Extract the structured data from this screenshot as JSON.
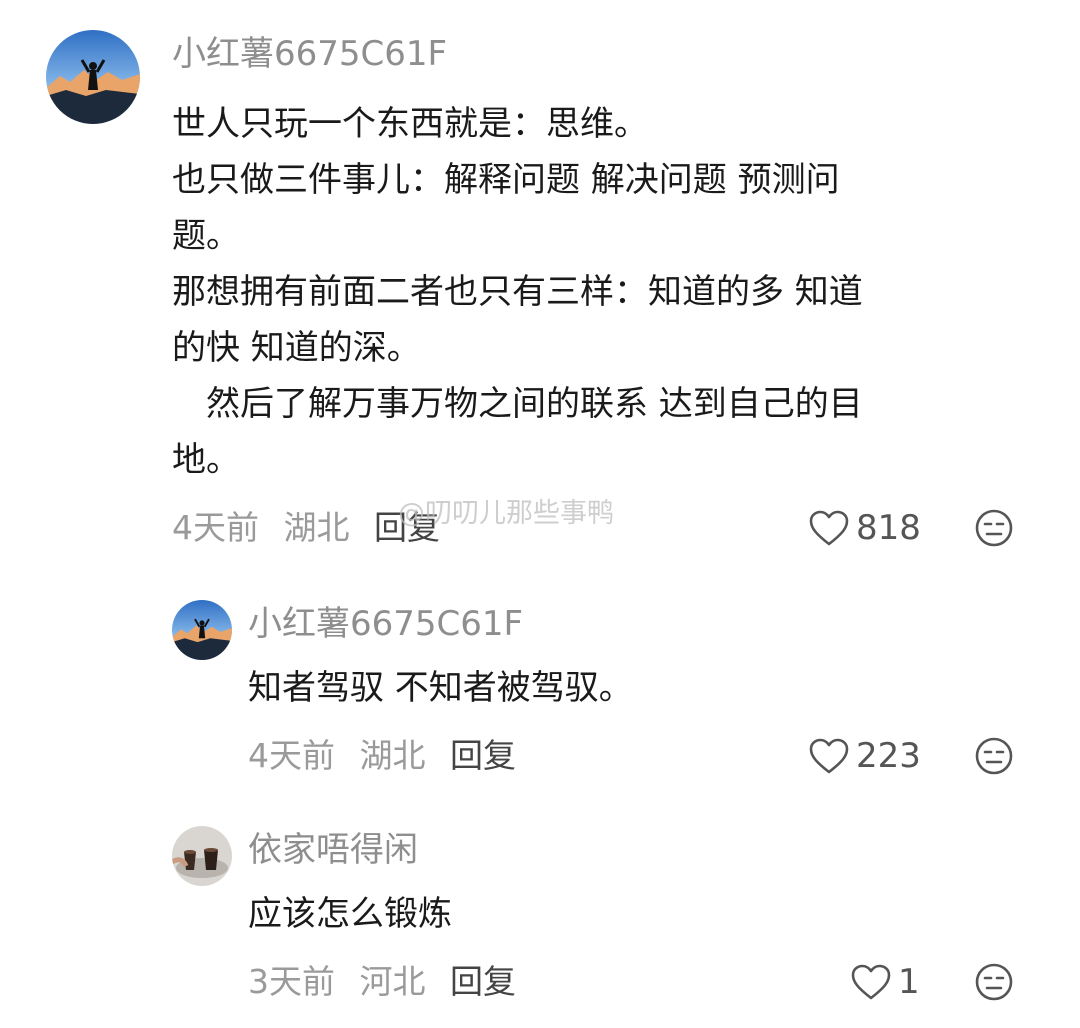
{
  "comments": [
    {
      "username": "小红薯6675C61F",
      "lines": [
        "世人只玩一个东西就是：思维。",
        "也只做三件事儿：解释问题 解决问题 预测问",
        "题。",
        "那想拥有前面二者也只有三样：知道的多 知道",
        "的快 知道的深。",
        "　然后了解万事万物之间的联系 达到自己的目",
        "地。"
      ],
      "time": "4天前",
      "location": "湖北",
      "reply_label": "回复",
      "likes": "818"
    },
    {
      "username": "小红薯6675C61F",
      "lines": [
        "知者驾驭 不知者被驾驭。"
      ],
      "time": "4天前",
      "location": "湖北",
      "reply_label": "回复",
      "likes": "223"
    },
    {
      "username": "依家唔得闲",
      "lines": [
        "应该怎么锻炼"
      ],
      "time": "3天前",
      "location": "河北",
      "reply_label": "回复",
      "likes": "1"
    }
  ],
  "watermark": "@叨叨儿那些事鸭",
  "icons": {
    "like": "heart-outline-icon",
    "emoji": "neutral-face-icon"
  }
}
